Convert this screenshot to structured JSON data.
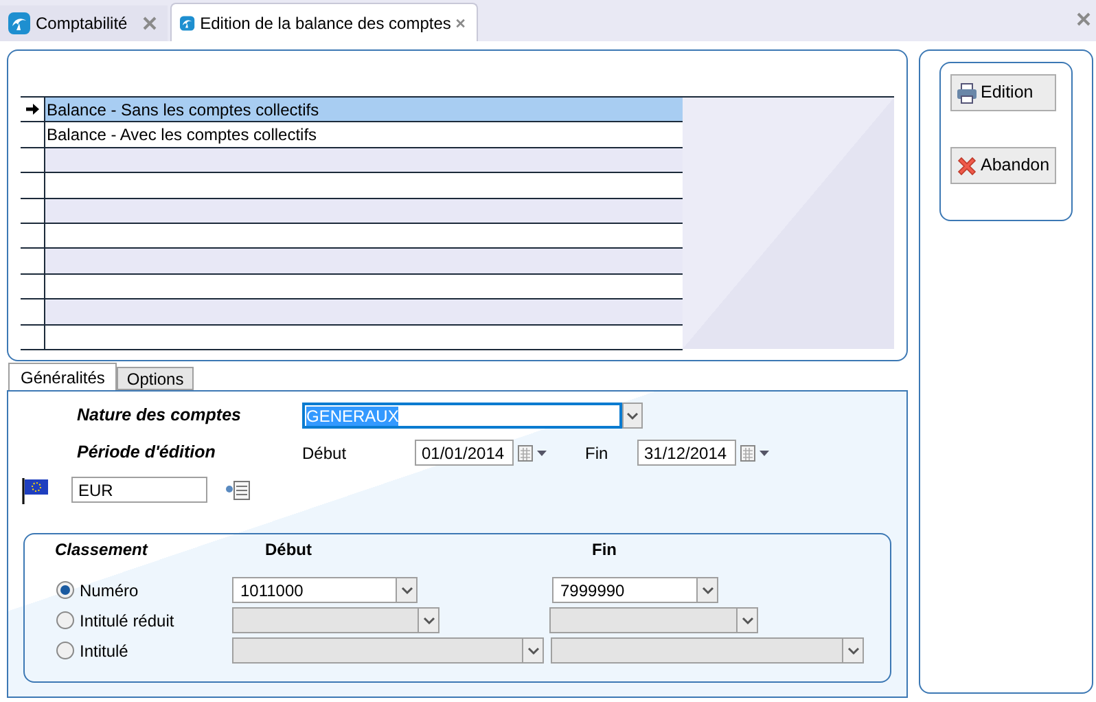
{
  "window_tabs": [
    {
      "label": "Comptabilité",
      "selected": false
    },
    {
      "label": "Edition de la balance des comptes",
      "selected": true
    }
  ],
  "list": {
    "rows": [
      {
        "label": "Balance - Sans les comptes collectifs",
        "selected": true
      },
      {
        "label": "Balance - Avec les comptes collectifs",
        "selected": false
      }
    ]
  },
  "form_tabs": [
    {
      "label": "Généralités",
      "selected": true
    },
    {
      "label": "Options",
      "selected": false
    }
  ],
  "nature": {
    "label": "Nature des comptes",
    "value": "GENERAUX"
  },
  "periode": {
    "label": "Période d'édition",
    "start_label": "Début",
    "start": "01/01/2014",
    "end_label": "Fin",
    "end": "31/12/2014"
  },
  "currency": {
    "value": "EUR"
  },
  "classement": {
    "title": "Classement",
    "start_heading": "Début",
    "end_heading": "Fin",
    "options": [
      {
        "label": "Numéro",
        "selected": true,
        "disabled": false,
        "start": "1011000",
        "end": "7999990"
      },
      {
        "label": "Intitulé réduit",
        "selected": false,
        "disabled": true
      },
      {
        "label": "Intitulé",
        "selected": false,
        "disabled": true
      }
    ]
  },
  "buttons": [
    {
      "label": "Edition",
      "kind": "print"
    },
    {
      "label": "Abandon",
      "kind": "cancel"
    }
  ]
}
